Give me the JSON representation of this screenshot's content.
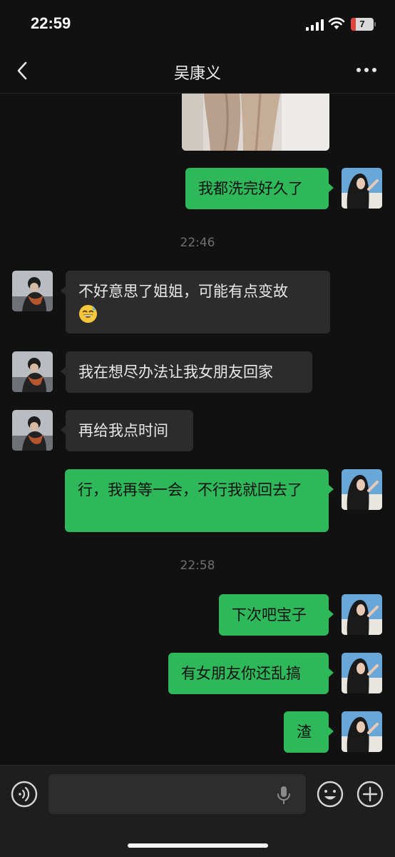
{
  "status_bar": {
    "time": "22:59",
    "battery_level": "7",
    "icons": [
      "cellular-signal-icon",
      "wifi-icon",
      "battery-icon"
    ]
  },
  "nav": {
    "title": "吴康义",
    "back_icon": "chevron-left-icon",
    "more_icon": "more-dots-icon"
  },
  "messages": [
    {
      "type": "image",
      "sender": "self",
      "description_icon": "shared-photo"
    },
    {
      "type": "text",
      "sender": "self",
      "text": "我都洗完好久了"
    },
    {
      "type": "timestamp",
      "text": "22:46"
    },
    {
      "type": "text",
      "sender": "other",
      "text": "不好意思了姐姐，可能有点变故",
      "emoji": "sweat-smile-emoji"
    },
    {
      "type": "text",
      "sender": "other",
      "text": "我在想尽办法让我女朋友回家"
    },
    {
      "type": "text",
      "sender": "other",
      "text": "再给我点时间"
    },
    {
      "type": "text",
      "sender": "self",
      "text": "行，我再等一会，不行我就回去了"
    },
    {
      "type": "timestamp",
      "text": "22:58"
    },
    {
      "type": "text",
      "sender": "self",
      "text": "下次吧宝子"
    },
    {
      "type": "text",
      "sender": "self",
      "text": "有女朋友你还乱搞"
    },
    {
      "type": "text",
      "sender": "self",
      "text": "渣"
    }
  ],
  "input_bar": {
    "voice_icon": "voice-input-icon",
    "mic_icon": "microphone-icon",
    "emoji_icon": "emoji-icon",
    "plus_icon": "plus-icon",
    "value": ""
  },
  "colors": {
    "background": "#111111",
    "outgoing_bubble": "#2fb85a",
    "incoming_bubble": "#2c2c2c",
    "timestamp": "#6f6f6f",
    "battery_low": "#e0443e"
  }
}
